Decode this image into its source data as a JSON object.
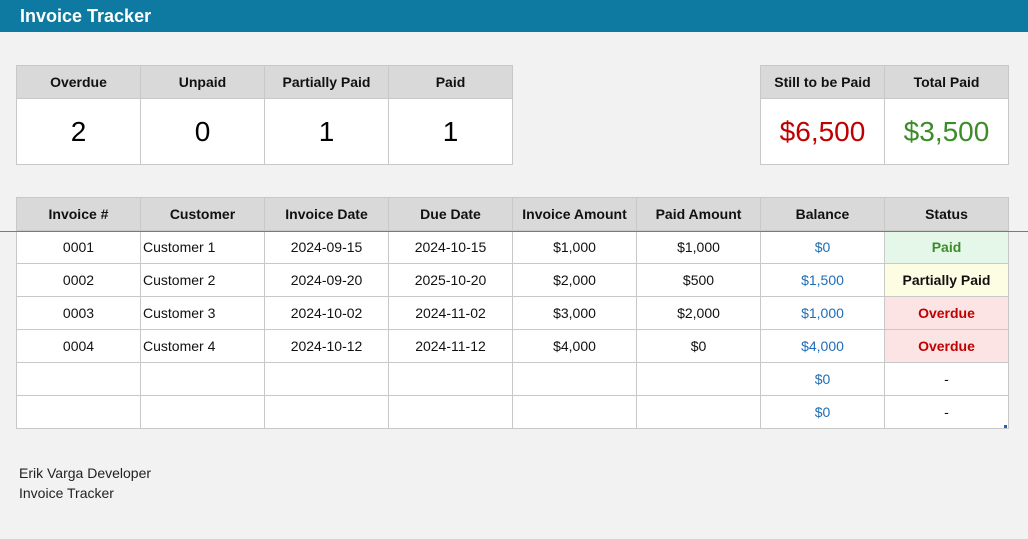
{
  "app": {
    "title": "Invoice Tracker"
  },
  "kpis": {
    "counts": [
      {
        "label": "Overdue",
        "value": "2"
      },
      {
        "label": "Unpaid",
        "value": "0"
      },
      {
        "label": "Partially Paid",
        "value": "1"
      },
      {
        "label": "Paid",
        "value": "1"
      }
    ],
    "money": [
      {
        "label": "Still to be Paid",
        "value": "$6,500",
        "color": "#c00000"
      },
      {
        "label": "Total Paid",
        "value": "$3,500",
        "color": "#3c8c2a"
      }
    ]
  },
  "table": {
    "headers": [
      "Invoice #",
      "Customer",
      "Invoice Date",
      "Due Date",
      "Invoice Amount",
      "Paid Amount",
      "Balance",
      "Status"
    ],
    "rows": [
      [
        "0001",
        "Customer 1",
        "2024-09-15",
        "2024-10-15",
        "$1,000",
        "$1,000",
        "$0",
        "Paid"
      ],
      [
        "0002",
        "Customer 2",
        "2024-09-20",
        "2025-10-20",
        "$2,000",
        "$500",
        "$1,500",
        "Partially Paid"
      ],
      [
        "0003",
        "Customer 3",
        "2024-10-02",
        "2024-11-02",
        "$3,000",
        "$2,000",
        "$1,000",
        "Overdue"
      ],
      [
        "0004",
        "Customer 4",
        "2024-10-12",
        "2024-11-12",
        "$4,000",
        "$0",
        "$4,000",
        "Overdue"
      ],
      [
        "",
        "",
        "",
        "",
        "",
        "",
        "$0",
        "-"
      ],
      [
        "",
        "",
        "",
        "",
        "",
        "",
        "$0",
        "-"
      ]
    ],
    "status_colors": {
      "Paid": "#3c8c2a",
      "Partially Paid": "#111111",
      "Overdue": "#c00000"
    }
  },
  "footer": {
    "line1": "Erik Varga Developer",
    "line2": "Invoice Tracker"
  }
}
